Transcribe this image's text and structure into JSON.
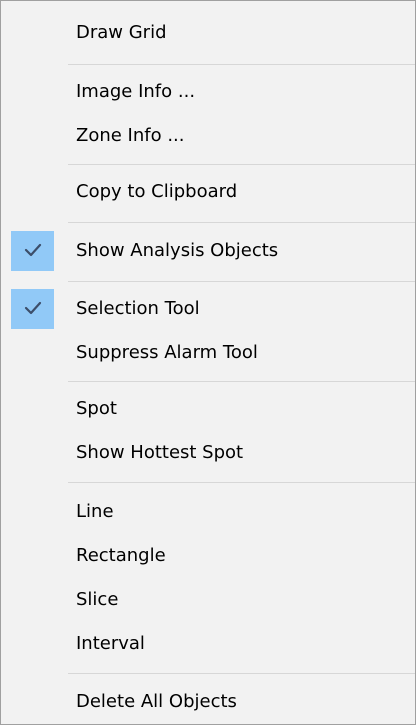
{
  "context_menu": {
    "items": [
      {
        "label": "Draw Grid",
        "checked": false
      },
      {
        "label": "Image Info ...",
        "checked": false
      },
      {
        "label": "Zone Info ...",
        "checked": false
      },
      {
        "label": "Copy to Clipboard",
        "checked": false
      },
      {
        "label": "Show Analysis Objects",
        "checked": true
      },
      {
        "label": "Selection Tool",
        "checked": true
      },
      {
        "label": "Suppress Alarm Tool",
        "checked": false
      },
      {
        "label": "Spot",
        "checked": false
      },
      {
        "label": "Show Hottest Spot",
        "checked": false
      },
      {
        "label": "Line",
        "checked": false
      },
      {
        "label": "Rectangle",
        "checked": false
      },
      {
        "label": "Slice",
        "checked": false
      },
      {
        "label": "Interval",
        "checked": false
      },
      {
        "label": "Delete All Objects",
        "checked": false
      }
    ],
    "colors": {
      "background": "#f2f2f2",
      "check_highlight": "#91c9f7",
      "check_mark": "#3c4e6a",
      "separator": "#d7d7d7"
    }
  }
}
